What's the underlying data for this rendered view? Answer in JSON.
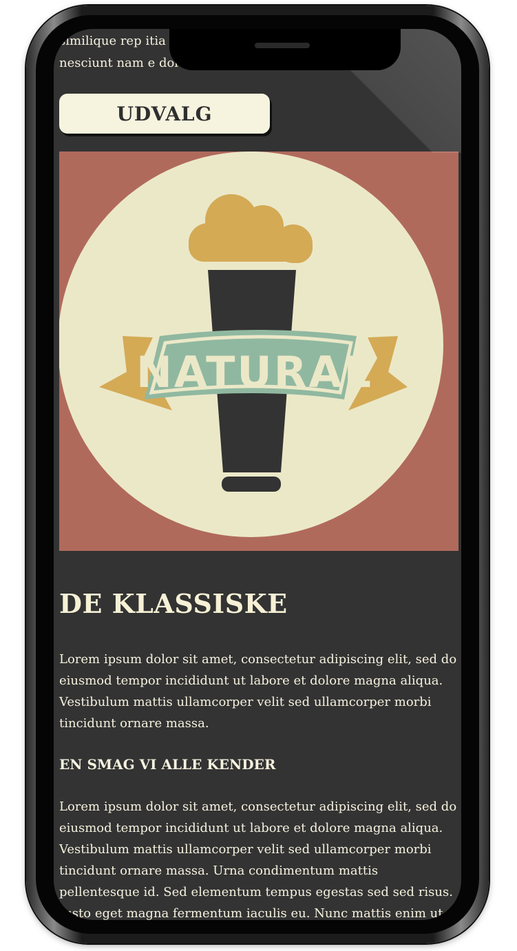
{
  "intro": {
    "line1": "similique rep                                          itia suscipit",
    "line2": "nesciunt nam                                          e dolores!"
  },
  "nav": {
    "udvalg_label": "UDVALG"
  },
  "logo": {
    "text": "NATURAL",
    "colors": {
      "background": "#b06a5c",
      "circle": "#ebe8c8",
      "foam": "#d4aa55",
      "glass": "#333333",
      "ribbon": "#90b8a0",
      "ribbon_tail": "#d4aa55"
    }
  },
  "section": {
    "heading": "DE KLASSISKE",
    "paragraph1": "Lorem ipsum dolor sit amet, consectetur adipiscing elit, sed do eiusmod tempor incididunt ut labore et dolore magna aliqua. Vestibulum mattis ullamcorper velit sed ullamcorper morbi tincidunt ornare massa.",
    "subheading": "EN SMAG VI ALLE KENDER",
    "paragraph2": "Lorem ipsum dolor sit amet, consectetur adipiscing elit, sed do eiusmod tempor incididunt ut labore et dolore magna aliqua. Vestibulum mattis ullamcorper velit sed ullamcorper morbi tincidunt ornare massa. Urna condimentum mattis pellentesque id. Sed elementum tempus egestas sed sed risus. Justo eget magna fermentum iaculis eu. Nunc mattis enim ut"
  },
  "colors": {
    "screen_bg": "#333333",
    "text": "#f5f1df",
    "button_bg": "#f6f3df"
  }
}
